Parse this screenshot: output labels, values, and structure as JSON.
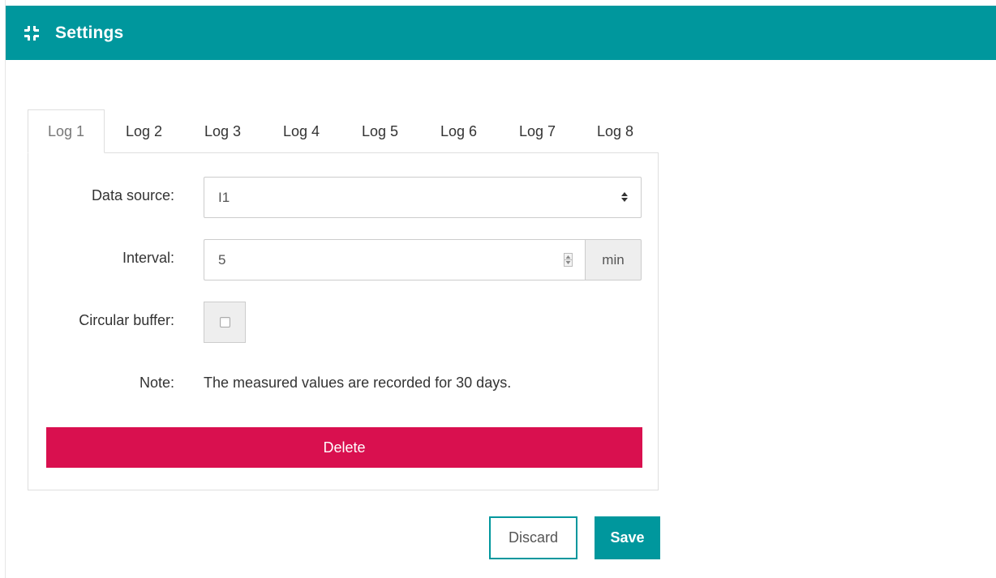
{
  "header": {
    "title": "Settings",
    "icon": "collapse-icon",
    "color": "#00979d"
  },
  "tabs": [
    {
      "label": "Log 1",
      "active": true
    },
    {
      "label": "Log 2",
      "active": false
    },
    {
      "label": "Log 3",
      "active": false
    },
    {
      "label": "Log 4",
      "active": false
    },
    {
      "label": "Log 5",
      "active": false
    },
    {
      "label": "Log 6",
      "active": false
    },
    {
      "label": "Log 7",
      "active": false
    },
    {
      "label": "Log 8",
      "active": false
    }
  ],
  "form": {
    "data_source": {
      "label": "Data source:",
      "value": "I1"
    },
    "interval": {
      "label": "Interval:",
      "value": "5",
      "unit": "min"
    },
    "circular_buffer": {
      "label": "Circular buffer:",
      "checked": false
    },
    "note": {
      "label": "Note:",
      "text": "The measured values are recorded for 30 days."
    },
    "delete_label": "Delete",
    "delete_color": "#d9104f"
  },
  "footer": {
    "discard_label": "Discard",
    "save_label": "Save"
  }
}
